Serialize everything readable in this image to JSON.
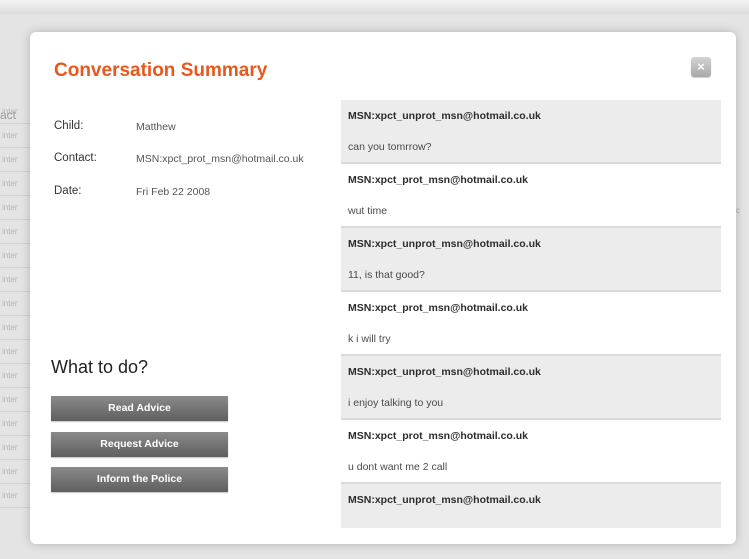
{
  "background": {
    "header_fragment": "act",
    "row_fragment": "inter",
    "right_fragment": "c"
  },
  "modal": {
    "title": "Conversation Summary",
    "close_glyph": "×",
    "details": {
      "child_label": "Child:",
      "child_value": "Matthew",
      "contact_label": "Contact:",
      "contact_value": "MSN:xpct_prot_msn@hotmail.co.uk",
      "date_label": "Date:",
      "date_value": "Fri Feb 22 2008"
    },
    "what_to_do": "What to do?",
    "actions": {
      "read_advice": "Read Advice",
      "request_advice": "Request Advice",
      "inform_police": "Inform the Police"
    },
    "messages": [
      {
        "sender": "MSN:xpct_unprot_msn@hotmail.co.uk",
        "text": "can you tomrrow?"
      },
      {
        "sender": "MSN:xpct_prot_msn@hotmail.co.uk",
        "text": "wut time"
      },
      {
        "sender": "MSN:xpct_unprot_msn@hotmail.co.uk",
        "text": "11, is that good?"
      },
      {
        "sender": "MSN:xpct_prot_msn@hotmail.co.uk",
        "text": "k i will try"
      },
      {
        "sender": "MSN:xpct_unprot_msn@hotmail.co.uk",
        "text": "i enjoy talking to you"
      },
      {
        "sender": "MSN:xpct_prot_msn@hotmail.co.uk",
        "text": "u dont want me 2 call"
      },
      {
        "sender": "MSN:xpct_unprot_msn@hotmail.co.uk",
        "text": ""
      }
    ]
  },
  "colors": {
    "title_accent": "#e8571c",
    "button_gray": "#6f6f6f",
    "message_alt_bg": "#ececec"
  }
}
